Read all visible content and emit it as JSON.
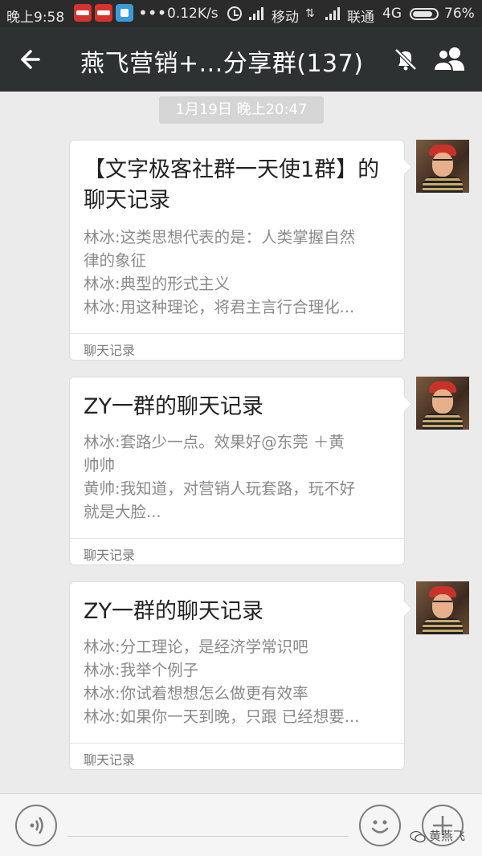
{
  "status_bar": {
    "time": "晚上9:58",
    "speed": "0.12K/s",
    "carrier1": "移动",
    "carrier2": "联通",
    "network": "4G",
    "battery": "76%",
    "icons": [
      "app-notification-icon",
      "app-notification-icon",
      "app-icon",
      "more-dots-icon",
      "alarm-clock-icon",
      "signal-icon",
      "signal-icon",
      "battery-icon"
    ]
  },
  "header": {
    "title": "燕飞营销+...分享群(137)",
    "back_icon": "back-arrow-icon",
    "mute_icon": "mute-bell-icon",
    "members_icon": "group-members-icon",
    "background": "#2e3132"
  },
  "timestamp": "1月19日 晚上20:47",
  "messages": [
    {
      "title": "【文字极客社群一天使1群】的聊天记录",
      "lines": [
        "林冰:这类思想代表的是：人类掌握自然",
        "律的象征",
        "林冰:典型的形式主义",
        "林冰:用这种理论，将君主言行合理化..."
      ],
      "footer": "聊天记录"
    },
    {
      "title": "ZY一群的聊天记录",
      "lines": [
        "林冰:套路少一点。效果好@东莞 ＋黄",
        "帅帅",
        "黄帅:我知道，对营销人玩套路，玩不好",
        "就是大脸..."
      ],
      "footer": "聊天记录"
    },
    {
      "title": "ZY一群的聊天记录",
      "lines": [
        "林冰:分工理论，是经济学常识吧",
        "林冰:我举个例子",
        "林冰:你试着想想怎么做更有效率",
        "林冰:如果你一天到晚，只跟 已经想要..."
      ],
      "footer": "聊天记录"
    }
  ],
  "bottom_bar": {
    "voice_icon": "voice-input-icon",
    "emoji_icon": "emoji-icon",
    "plus_icon": "plus-icon"
  },
  "watermark": "黄燕飞",
  "colors": {
    "chat_background": "#ebebeb",
    "bubble": "#ffffff",
    "timestamp_bg": "#d5d5d5"
  }
}
